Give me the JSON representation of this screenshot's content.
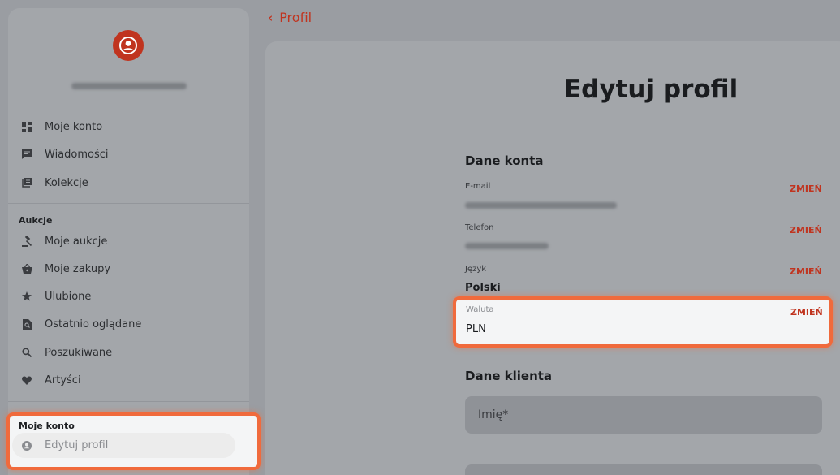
{
  "sidebar": {
    "menu": [
      {
        "label": "Moje konto",
        "icon": "dashboard-icon"
      },
      {
        "label": "Wiadomości",
        "icon": "message-icon"
      },
      {
        "label": "Kolekcje",
        "icon": "collections-icon"
      }
    ],
    "auctions_title": "Aukcje",
    "auctions": [
      {
        "label": "Moje aukcje",
        "icon": "gavel-icon"
      },
      {
        "label": "Moje zakupy",
        "icon": "basket-icon"
      },
      {
        "label": "Ulubione",
        "icon": "star-icon"
      },
      {
        "label": "Ostatnio oglądane",
        "icon": "recent-view-icon"
      },
      {
        "label": "Poszukiwane",
        "icon": "search-icon"
      },
      {
        "label": "Artyści",
        "icon": "heart-icon"
      }
    ],
    "account_title": "Moje konto",
    "account_item": {
      "label": "Edytuj profil",
      "icon": "user-circle-icon"
    }
  },
  "breadcrumb": {
    "back_label": "Profil"
  },
  "main": {
    "title": "Edytuj profil",
    "account_section": "Dane konta",
    "fields": {
      "email": {
        "label": "E-mail",
        "action": "ZMIEŃ"
      },
      "phone": {
        "label": "Telefon",
        "action": "ZMIEŃ"
      },
      "language": {
        "label": "Język",
        "value": "Polski",
        "action": "ZMIEŃ"
      },
      "currency": {
        "label": "Waluta",
        "value": "PLN",
        "action": "ZMIEŃ"
      }
    },
    "client_section": "Dane klienta",
    "first_name_placeholder": "Imię*"
  },
  "colors": {
    "accent": "#c0341f",
    "highlight": "#f06a3c"
  }
}
